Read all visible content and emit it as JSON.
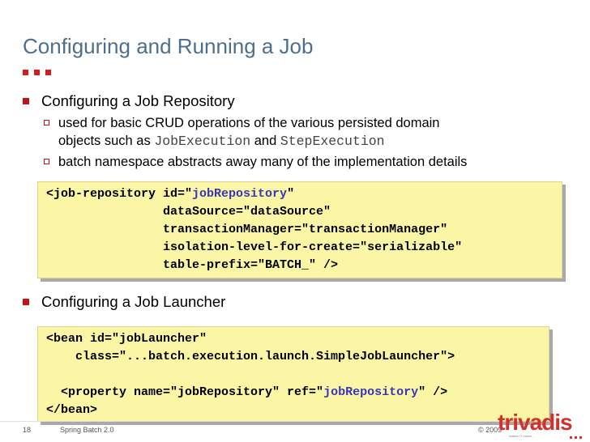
{
  "slide": {
    "title": "Configuring and Running a Job",
    "bullet_1": "Configuring a Job Repository",
    "sub_1_line_1": "used for basic CRUD operations of the various persisted domain",
    "sub_1_line_2_pre": "objects such as ",
    "sub_1_code_1": "JobExecution",
    "sub_1_mid": " and ",
    "sub_1_code_2": "StepExecution",
    "sub_2": "batch namespace abstracts away many of the implementation details",
    "bullet_2": "Configuring a Job Launcher"
  },
  "code_1": {
    "line_1_a": "<job-repository id=\"",
    "line_1_hl": "jobRepository",
    "line_1_b": "\"",
    "line_2": "                dataSource=\"dataSource\"",
    "line_3": "                transactionManager=\"transactionManager\"",
    "line_4": "                isolation-level-for-create=\"serializable\"",
    "line_5": "                table-prefix=\"BATCH_\" />"
  },
  "code_2": {
    "line_1": "<bean id=\"jobLauncher\"",
    "line_2": "    class=\"...batch.execution.launch.SimpleJobLauncher\">",
    "line_3": "",
    "line_4_a": "  <property name=\"jobRepository\" ref=\"",
    "line_4_hl": "jobRepository",
    "line_4_b": "\" />",
    "line_5": "</bean>"
  },
  "footer": {
    "page_number": "18",
    "course": "Spring Batch 2.0",
    "copyright": "© 2009"
  },
  "logo": {
    "name": "trivadis",
    "tagline": "makes IT easier."
  },
  "colors": {
    "title": "#4d6f8c",
    "accent_red": "#c0141b",
    "code_background": "#fbf6a6",
    "code_highlight": "#3737b8"
  }
}
